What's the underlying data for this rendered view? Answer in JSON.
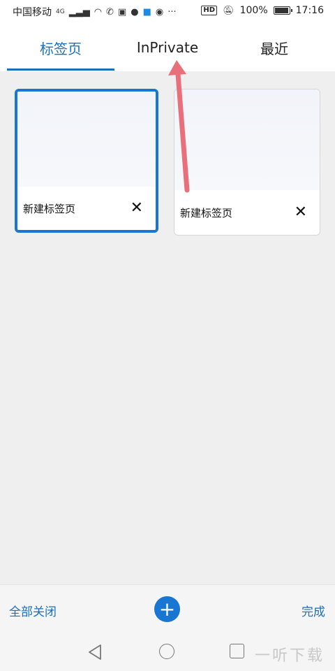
{
  "status_bar": {
    "carrier": "中国移动",
    "network": "4G",
    "time": "17:16",
    "battery": "100%",
    "battery_level": 1.0,
    "hd_label": "HD",
    "more": "···"
  },
  "tabs": [
    {
      "label": "标签页",
      "active": true
    },
    {
      "label": "InPrivate",
      "active": false
    },
    {
      "label": "最近",
      "active": false
    }
  ],
  "tab_cards": [
    {
      "title": "新建标签页",
      "close": "✕",
      "selected": true
    },
    {
      "title": "新建标签页",
      "close": "✕",
      "selected": false
    }
  ],
  "bottom_bar": {
    "close_all": "全部关闭",
    "add": "+",
    "done": "完成"
  },
  "watermark": "一听下载",
  "colors": {
    "accent": "#1976d2",
    "arrow": "#e9707a",
    "background": "#efefef"
  }
}
